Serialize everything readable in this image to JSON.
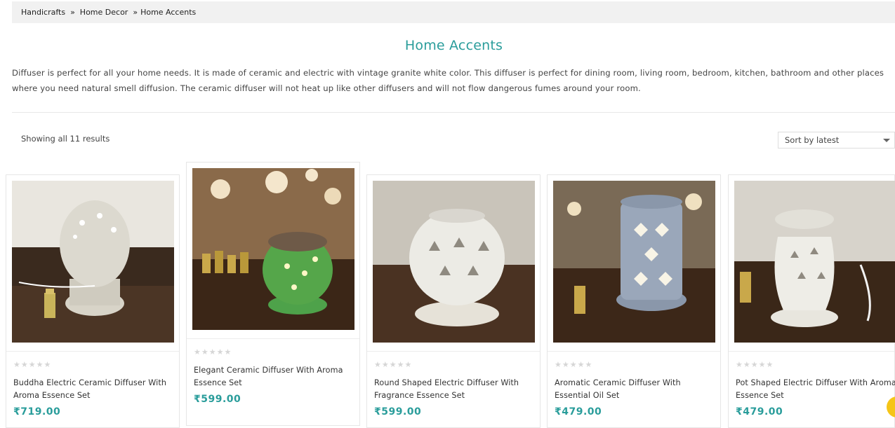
{
  "breadcrumb": {
    "items": [
      "Handicrafts",
      "Home Decor",
      "Home Accents"
    ],
    "separator": "»"
  },
  "title": "Home Accents",
  "description": "Diffuser is perfect for all your home needs. It is made of ceramic and electric with vintage granite white color. This diffuser is perfect for dining room, living room, bedroom, kitchen, bathroom and other places where you need natural smell diffusion. The ceramic diffuser will not heat up like other diffusers and will not flow dangerous fumes around your room.",
  "result_count": "Showing all 11 results",
  "sort": {
    "selected": "Sort by latest"
  },
  "colors": {
    "accent": "#2a9d9b",
    "scroll_button": "#f5c518"
  },
  "products": [
    {
      "name": "Buddha Electric Ceramic Diffuser With Aroma Essence Set",
      "price": "₹719.00",
      "stars": "★★★★★",
      "rating": 0
    },
    {
      "name": "Elegant Ceramic Diffuser With Aroma Essence Set",
      "price": "₹599.00",
      "stars": "★★★★★",
      "rating": 0
    },
    {
      "name": "Round Shaped Electric Diffuser With Fragrance Essence Set",
      "price": "₹599.00",
      "stars": "★★★★★",
      "rating": 0
    },
    {
      "name": "Aromatic Ceramic Diffuser With Essential Oil Set",
      "price": "₹479.00",
      "stars": "★★★★★",
      "rating": 0
    },
    {
      "name": "Pot Shaped Electric Diffuser With Aroma Essence Set",
      "price": "₹479.00",
      "stars": "★★★★★",
      "rating": 0
    }
  ]
}
